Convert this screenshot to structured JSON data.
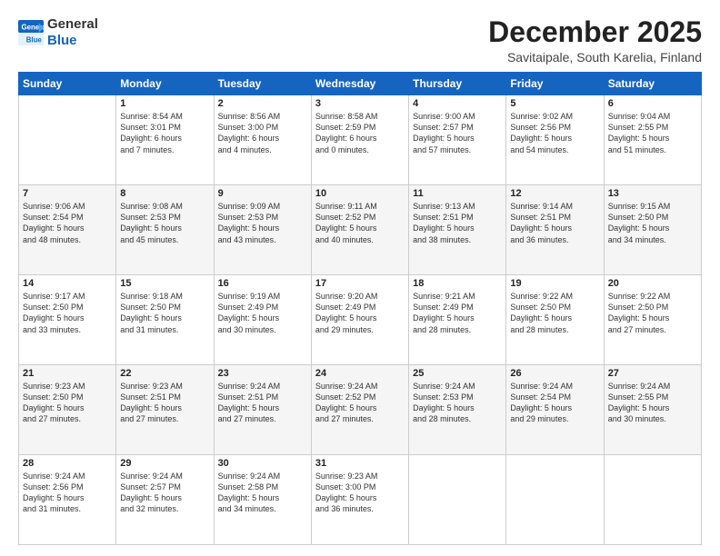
{
  "header": {
    "logo": {
      "general": "General",
      "blue": "Blue"
    },
    "title": "December 2025",
    "location": "Savitaipale, South Karelia, Finland"
  },
  "days_of_week": [
    "Sunday",
    "Monday",
    "Tuesday",
    "Wednesday",
    "Thursday",
    "Friday",
    "Saturday"
  ],
  "weeks": [
    [
      {
        "day": "",
        "info": ""
      },
      {
        "day": "1",
        "info": "Sunrise: 8:54 AM\nSunset: 3:01 PM\nDaylight: 6 hours\nand 7 minutes."
      },
      {
        "day": "2",
        "info": "Sunrise: 8:56 AM\nSunset: 3:00 PM\nDaylight: 6 hours\nand 4 minutes."
      },
      {
        "day": "3",
        "info": "Sunrise: 8:58 AM\nSunset: 2:59 PM\nDaylight: 6 hours\nand 0 minutes."
      },
      {
        "day": "4",
        "info": "Sunrise: 9:00 AM\nSunset: 2:57 PM\nDaylight: 5 hours\nand 57 minutes."
      },
      {
        "day": "5",
        "info": "Sunrise: 9:02 AM\nSunset: 2:56 PM\nDaylight: 5 hours\nand 54 minutes."
      },
      {
        "day": "6",
        "info": "Sunrise: 9:04 AM\nSunset: 2:55 PM\nDaylight: 5 hours\nand 51 minutes."
      }
    ],
    [
      {
        "day": "7",
        "info": "Sunrise: 9:06 AM\nSunset: 2:54 PM\nDaylight: 5 hours\nand 48 minutes."
      },
      {
        "day": "8",
        "info": "Sunrise: 9:08 AM\nSunset: 2:53 PM\nDaylight: 5 hours\nand 45 minutes."
      },
      {
        "day": "9",
        "info": "Sunrise: 9:09 AM\nSunset: 2:53 PM\nDaylight: 5 hours\nand 43 minutes."
      },
      {
        "day": "10",
        "info": "Sunrise: 9:11 AM\nSunset: 2:52 PM\nDaylight: 5 hours\nand 40 minutes."
      },
      {
        "day": "11",
        "info": "Sunrise: 9:13 AM\nSunset: 2:51 PM\nDaylight: 5 hours\nand 38 minutes."
      },
      {
        "day": "12",
        "info": "Sunrise: 9:14 AM\nSunset: 2:51 PM\nDaylight: 5 hours\nand 36 minutes."
      },
      {
        "day": "13",
        "info": "Sunrise: 9:15 AM\nSunset: 2:50 PM\nDaylight: 5 hours\nand 34 minutes."
      }
    ],
    [
      {
        "day": "14",
        "info": "Sunrise: 9:17 AM\nSunset: 2:50 PM\nDaylight: 5 hours\nand 33 minutes."
      },
      {
        "day": "15",
        "info": "Sunrise: 9:18 AM\nSunset: 2:50 PM\nDaylight: 5 hours\nand 31 minutes."
      },
      {
        "day": "16",
        "info": "Sunrise: 9:19 AM\nSunset: 2:49 PM\nDaylight: 5 hours\nand 30 minutes."
      },
      {
        "day": "17",
        "info": "Sunrise: 9:20 AM\nSunset: 2:49 PM\nDaylight: 5 hours\nand 29 minutes."
      },
      {
        "day": "18",
        "info": "Sunrise: 9:21 AM\nSunset: 2:49 PM\nDaylight: 5 hours\nand 28 minutes."
      },
      {
        "day": "19",
        "info": "Sunrise: 9:22 AM\nSunset: 2:50 PM\nDaylight: 5 hours\nand 28 minutes."
      },
      {
        "day": "20",
        "info": "Sunrise: 9:22 AM\nSunset: 2:50 PM\nDaylight: 5 hours\nand 27 minutes."
      }
    ],
    [
      {
        "day": "21",
        "info": "Sunrise: 9:23 AM\nSunset: 2:50 PM\nDaylight: 5 hours\nand 27 minutes."
      },
      {
        "day": "22",
        "info": "Sunrise: 9:23 AM\nSunset: 2:51 PM\nDaylight: 5 hours\nand 27 minutes."
      },
      {
        "day": "23",
        "info": "Sunrise: 9:24 AM\nSunset: 2:51 PM\nDaylight: 5 hours\nand 27 minutes."
      },
      {
        "day": "24",
        "info": "Sunrise: 9:24 AM\nSunset: 2:52 PM\nDaylight: 5 hours\nand 27 minutes."
      },
      {
        "day": "25",
        "info": "Sunrise: 9:24 AM\nSunset: 2:53 PM\nDaylight: 5 hours\nand 28 minutes."
      },
      {
        "day": "26",
        "info": "Sunrise: 9:24 AM\nSunset: 2:54 PM\nDaylight: 5 hours\nand 29 minutes."
      },
      {
        "day": "27",
        "info": "Sunrise: 9:24 AM\nSunset: 2:55 PM\nDaylight: 5 hours\nand 30 minutes."
      }
    ],
    [
      {
        "day": "28",
        "info": "Sunrise: 9:24 AM\nSunset: 2:56 PM\nDaylight: 5 hours\nand 31 minutes."
      },
      {
        "day": "29",
        "info": "Sunrise: 9:24 AM\nSunset: 2:57 PM\nDaylight: 5 hours\nand 32 minutes."
      },
      {
        "day": "30",
        "info": "Sunrise: 9:24 AM\nSunset: 2:58 PM\nDaylight: 5 hours\nand 34 minutes."
      },
      {
        "day": "31",
        "info": "Sunrise: 9:23 AM\nSunset: 3:00 PM\nDaylight: 5 hours\nand 36 minutes."
      },
      {
        "day": "",
        "info": ""
      },
      {
        "day": "",
        "info": ""
      },
      {
        "day": "",
        "info": ""
      }
    ]
  ]
}
